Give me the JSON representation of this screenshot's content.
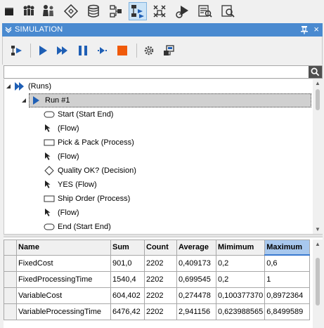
{
  "toolbar": {
    "items": [
      {
        "name": "console-icon",
        "active": false
      },
      {
        "name": "organization-icon",
        "active": false
      },
      {
        "name": "people-icon",
        "active": false
      },
      {
        "name": "decision-diamond-icon",
        "active": false
      },
      {
        "name": "database-icon",
        "active": false
      },
      {
        "name": "process-map-icon",
        "active": false
      },
      {
        "name": "simulation-icon",
        "active": true
      },
      {
        "name": "matrix-icon",
        "active": false
      },
      {
        "name": "run-report-icon",
        "active": false
      },
      {
        "name": "analysis-icon",
        "active": false
      },
      {
        "name": "search-report-icon",
        "active": false
      }
    ]
  },
  "panel": {
    "title": "SIMULATION",
    "close_glyph": "×"
  },
  "sim_toolbar": {
    "buttons": [
      "simulate-icon",
      "play-icon",
      "fast-forward-icon",
      "pause-icon",
      "step-icon",
      "stop-icon",
      "settings-icon",
      "export-icon"
    ]
  },
  "search": {
    "value": "",
    "placeholder": ""
  },
  "tree": {
    "root_label": "(Runs)",
    "run_label": "Run #1",
    "nodes": [
      {
        "icon": "start-end",
        "label": "Start (Start End)"
      },
      {
        "icon": "flow",
        "label": "(Flow)"
      },
      {
        "icon": "process",
        "label": "Pick & Pack (Process)"
      },
      {
        "icon": "flow",
        "label": "(Flow)"
      },
      {
        "icon": "decision",
        "label": "Quality OK? (Decision)"
      },
      {
        "icon": "flow",
        "label": "YES (Flow)"
      },
      {
        "icon": "process",
        "label": "Ship Order (Process)"
      },
      {
        "icon": "flow",
        "label": "(Flow)"
      },
      {
        "icon": "start-end",
        "label": "End (Start End)"
      }
    ]
  },
  "stats": {
    "columns": [
      "Name",
      "Sum",
      "Count",
      "Average",
      "Mimimum",
      "Maximum"
    ],
    "selected_column": "Maximum",
    "rows": [
      [
        "FixedCost",
        "901,0",
        "2202",
        "0,409173",
        "0,2",
        "0,6"
      ],
      [
        "FixedProcessingTime",
        "1540,4",
        "2202",
        "0,699545",
        "0,2",
        "1"
      ],
      [
        "VariableCost",
        "604,402",
        "2202",
        "0,274478",
        "0,100377370",
        "0,8972364"
      ],
      [
        "VariableProcessingTime",
        "6476,42",
        "2202",
        "2,941156",
        "0,623988565",
        "6,8499589"
      ]
    ]
  }
}
